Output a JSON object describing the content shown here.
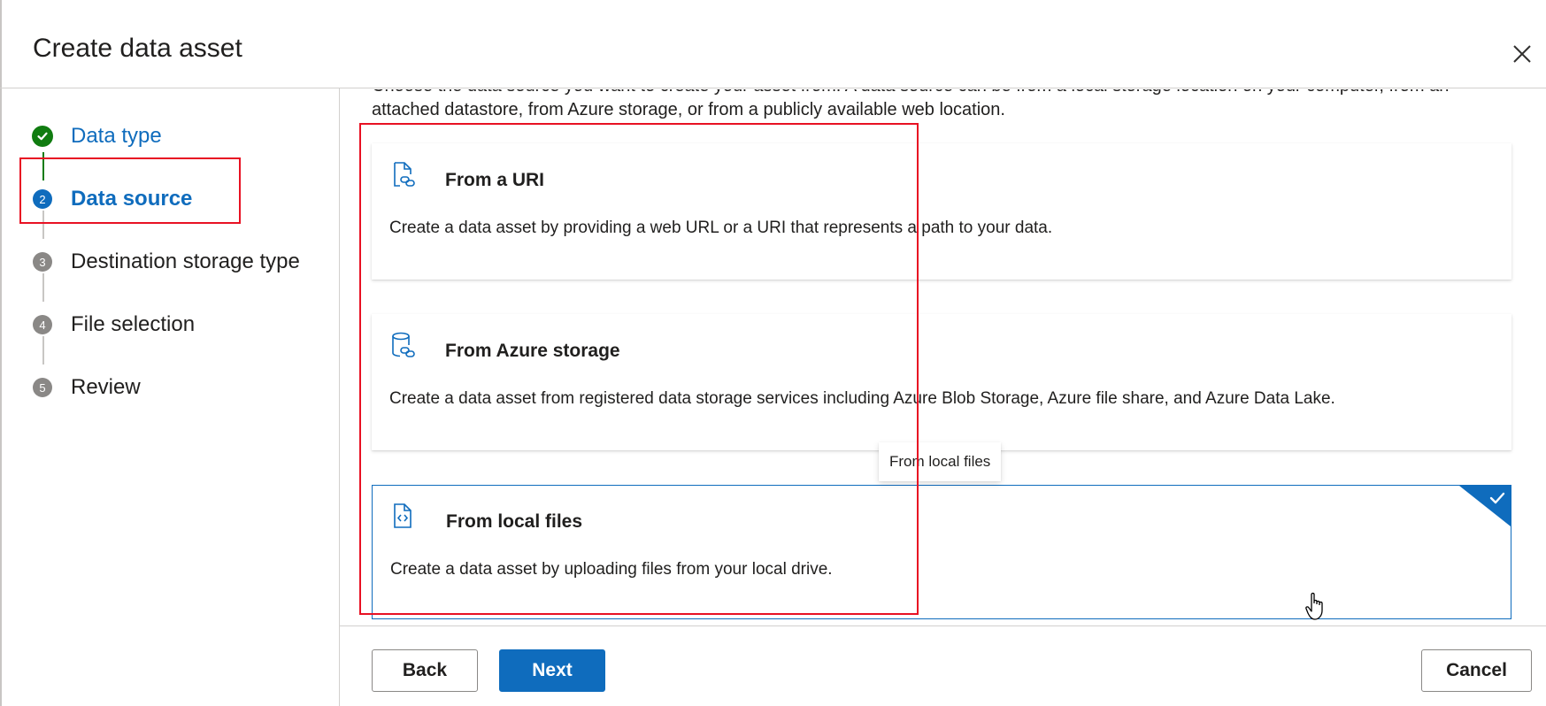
{
  "header": {
    "title": "Create data asset",
    "close_icon": "close-icon"
  },
  "stepper": {
    "steps": [
      {
        "number": "",
        "label": "Data type",
        "state": "completed"
      },
      {
        "number": "2",
        "label": "Data source",
        "state": "current"
      },
      {
        "number": "3",
        "label": "Destination storage type",
        "state": "pending"
      },
      {
        "number": "4",
        "label": "File selection",
        "state": "pending"
      },
      {
        "number": "5",
        "label": "Review",
        "state": "pending"
      }
    ]
  },
  "main": {
    "intro_line1": "Choose the data source you want to create your asset from. A data source can be from a local storage location on your computer, from an",
    "intro_line2": "attached datastore, from Azure storage, or from a publicly available web location.",
    "cards": [
      {
        "icon": "file-link-icon",
        "title": "From a URI",
        "description": "Create a data asset by providing a web URL or a URI that represents a path to your data.",
        "selected": false
      },
      {
        "icon": "database-link-icon",
        "title": "From Azure storage",
        "description": "Create a data asset from registered data storage services including Azure Blob Storage, Azure file share, and Azure Data Lake.",
        "selected": false
      },
      {
        "icon": "file-code-icon",
        "title": "From local files",
        "description": "Create a data asset by uploading files from your local drive.",
        "selected": true
      }
    ],
    "tooltip": "From local files"
  },
  "footer": {
    "back_label": "Back",
    "next_label": "Next",
    "cancel_label": "Cancel"
  },
  "colors": {
    "accent": "#0f6cbd",
    "success": "#107c10",
    "annotation": "#e81123"
  }
}
